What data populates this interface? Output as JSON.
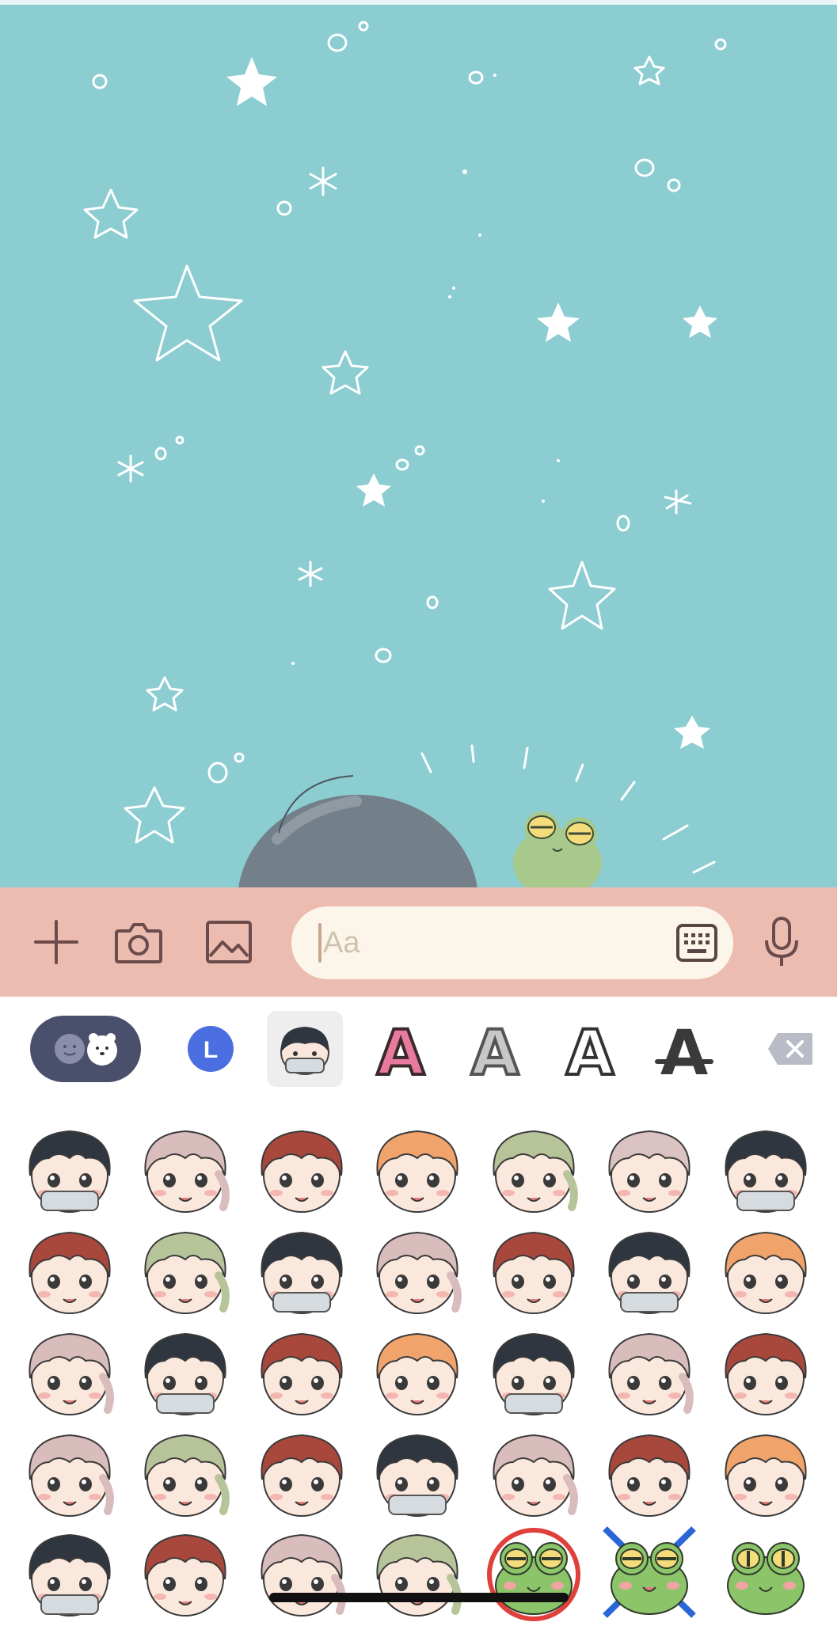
{
  "composer": {
    "placeholder": "Aa",
    "icons": [
      "plus-icon",
      "camera-icon",
      "image-icon",
      "keyboard-icon",
      "microphone-icon"
    ]
  },
  "tabbar": {
    "tabs": [
      {
        "name": "emoji-bear-tab",
        "selected": false
      },
      {
        "name": "line-emoji-tab",
        "label": "L",
        "selected": false
      },
      {
        "name": "character-sticker-tab",
        "selected": true
      },
      {
        "name": "pink-letter-a-tab",
        "label": "A"
      },
      {
        "name": "gray-letter-a-tab",
        "label": "A"
      },
      {
        "name": "outline-letter-a-tab",
        "label": "A"
      },
      {
        "name": "strike-letter-a-tab",
        "label": "A"
      }
    ],
    "delete_icon": "backspace-icon"
  },
  "colors": {
    "chat_background": "#8ccdd2",
    "composer_background": "#ecbcb0",
    "input_background": "#fcf6ea",
    "icon_color": "#6b4b4b"
  },
  "stickers": {
    "rows": 5,
    "columns": 7,
    "hair_colors": [
      [
        "#2f3640",
        "#d9bcbc",
        "#a8483d",
        "#f0a36a",
        "#b7c49a",
        "#dcc3c3",
        "#2f3640"
      ],
      [
        "#a8483d",
        "#b7c49a",
        "#2f3640",
        "#d9bcbc",
        "#a8483d",
        "#2f3640",
        "#f0a36a"
      ],
      [
        "#d9bcbc",
        "#2f3640",
        "#a8483d",
        "#f0a36a",
        "#2f3640",
        "#d9bcbc",
        "#a8483d"
      ],
      [
        "#d9bcbc",
        "#b7c49a",
        "#a8483d",
        "#2f3640",
        "#d9bcbc",
        "#a8483d",
        "#f0a36a"
      ],
      [
        "#2f3640",
        "#a8483d",
        "#d9bcbc",
        "#b7c49a",
        "frog",
        "frog",
        "frog"
      ]
    ]
  }
}
